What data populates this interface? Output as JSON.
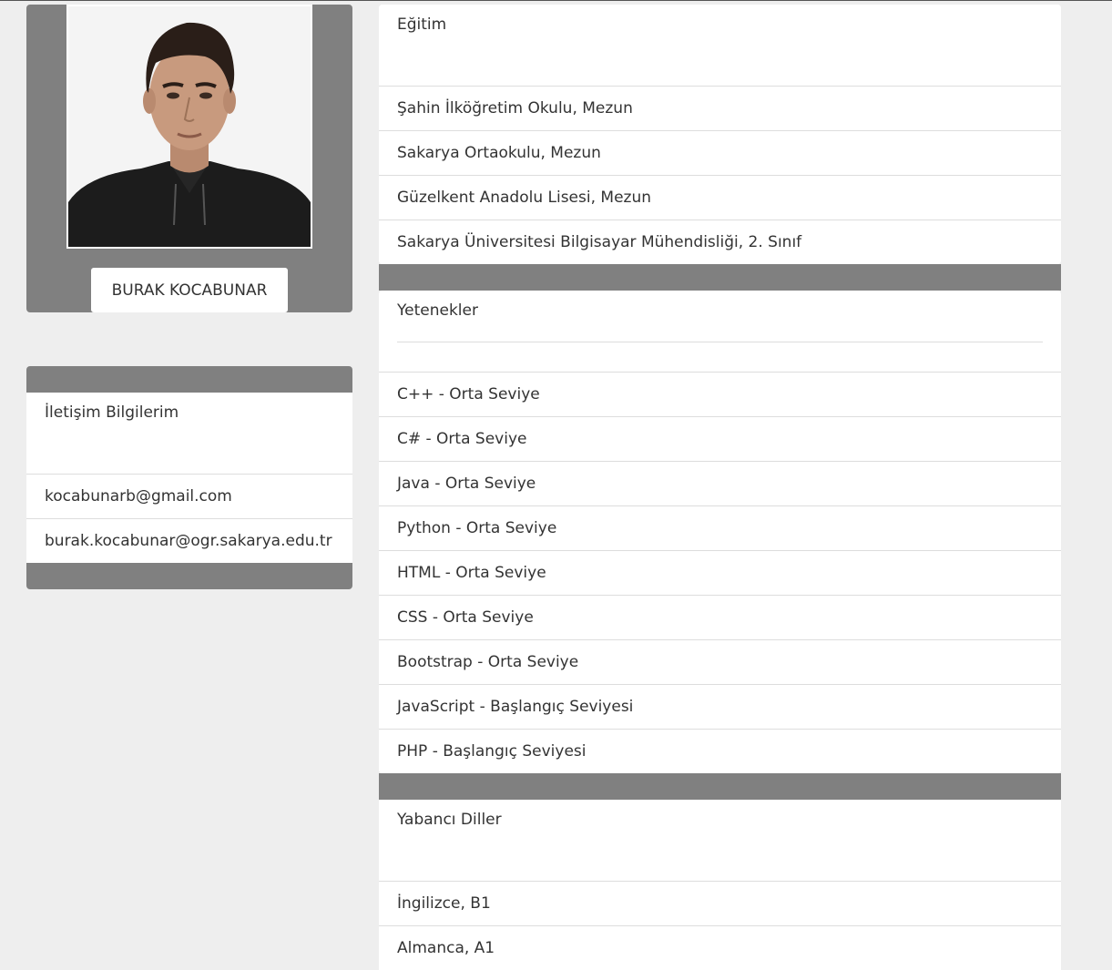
{
  "profile": {
    "name": "BURAK KOCABUNAR",
    "photo_alt": "Profile photo"
  },
  "contact": {
    "title": "İletişim Bilgilerim",
    "items": [
      "kocabunarb@gmail.com",
      "burak.kocabunar@ogr.sakarya.edu.tr"
    ]
  },
  "education": {
    "title": "Eğitim",
    "items": [
      "Şahin İlköğretim Okulu, Mezun",
      "Sakarya Ortaokulu, Mezun",
      "Güzelkent Anadolu Lisesi, Mezun",
      "Sakarya Üniversitesi Bilgisayar Mühendisliği, 2. Sınıf"
    ]
  },
  "skills": {
    "title": "Yetenekler",
    "items": [
      "C++ - Orta Seviye",
      "C# - Orta Seviye",
      "Java - Orta Seviye",
      "Python - Orta Seviye",
      "HTML - Orta Seviye",
      "CSS - Orta Seviye",
      "Bootstrap - Orta Seviye",
      "JavaScript - Başlangıç Seviyesi",
      "PHP - Başlangıç Seviyesi"
    ]
  },
  "languages": {
    "title": "Yabancı Diller",
    "items": [
      "İngilizce, B1",
      "Almanca, A1"
    ]
  }
}
